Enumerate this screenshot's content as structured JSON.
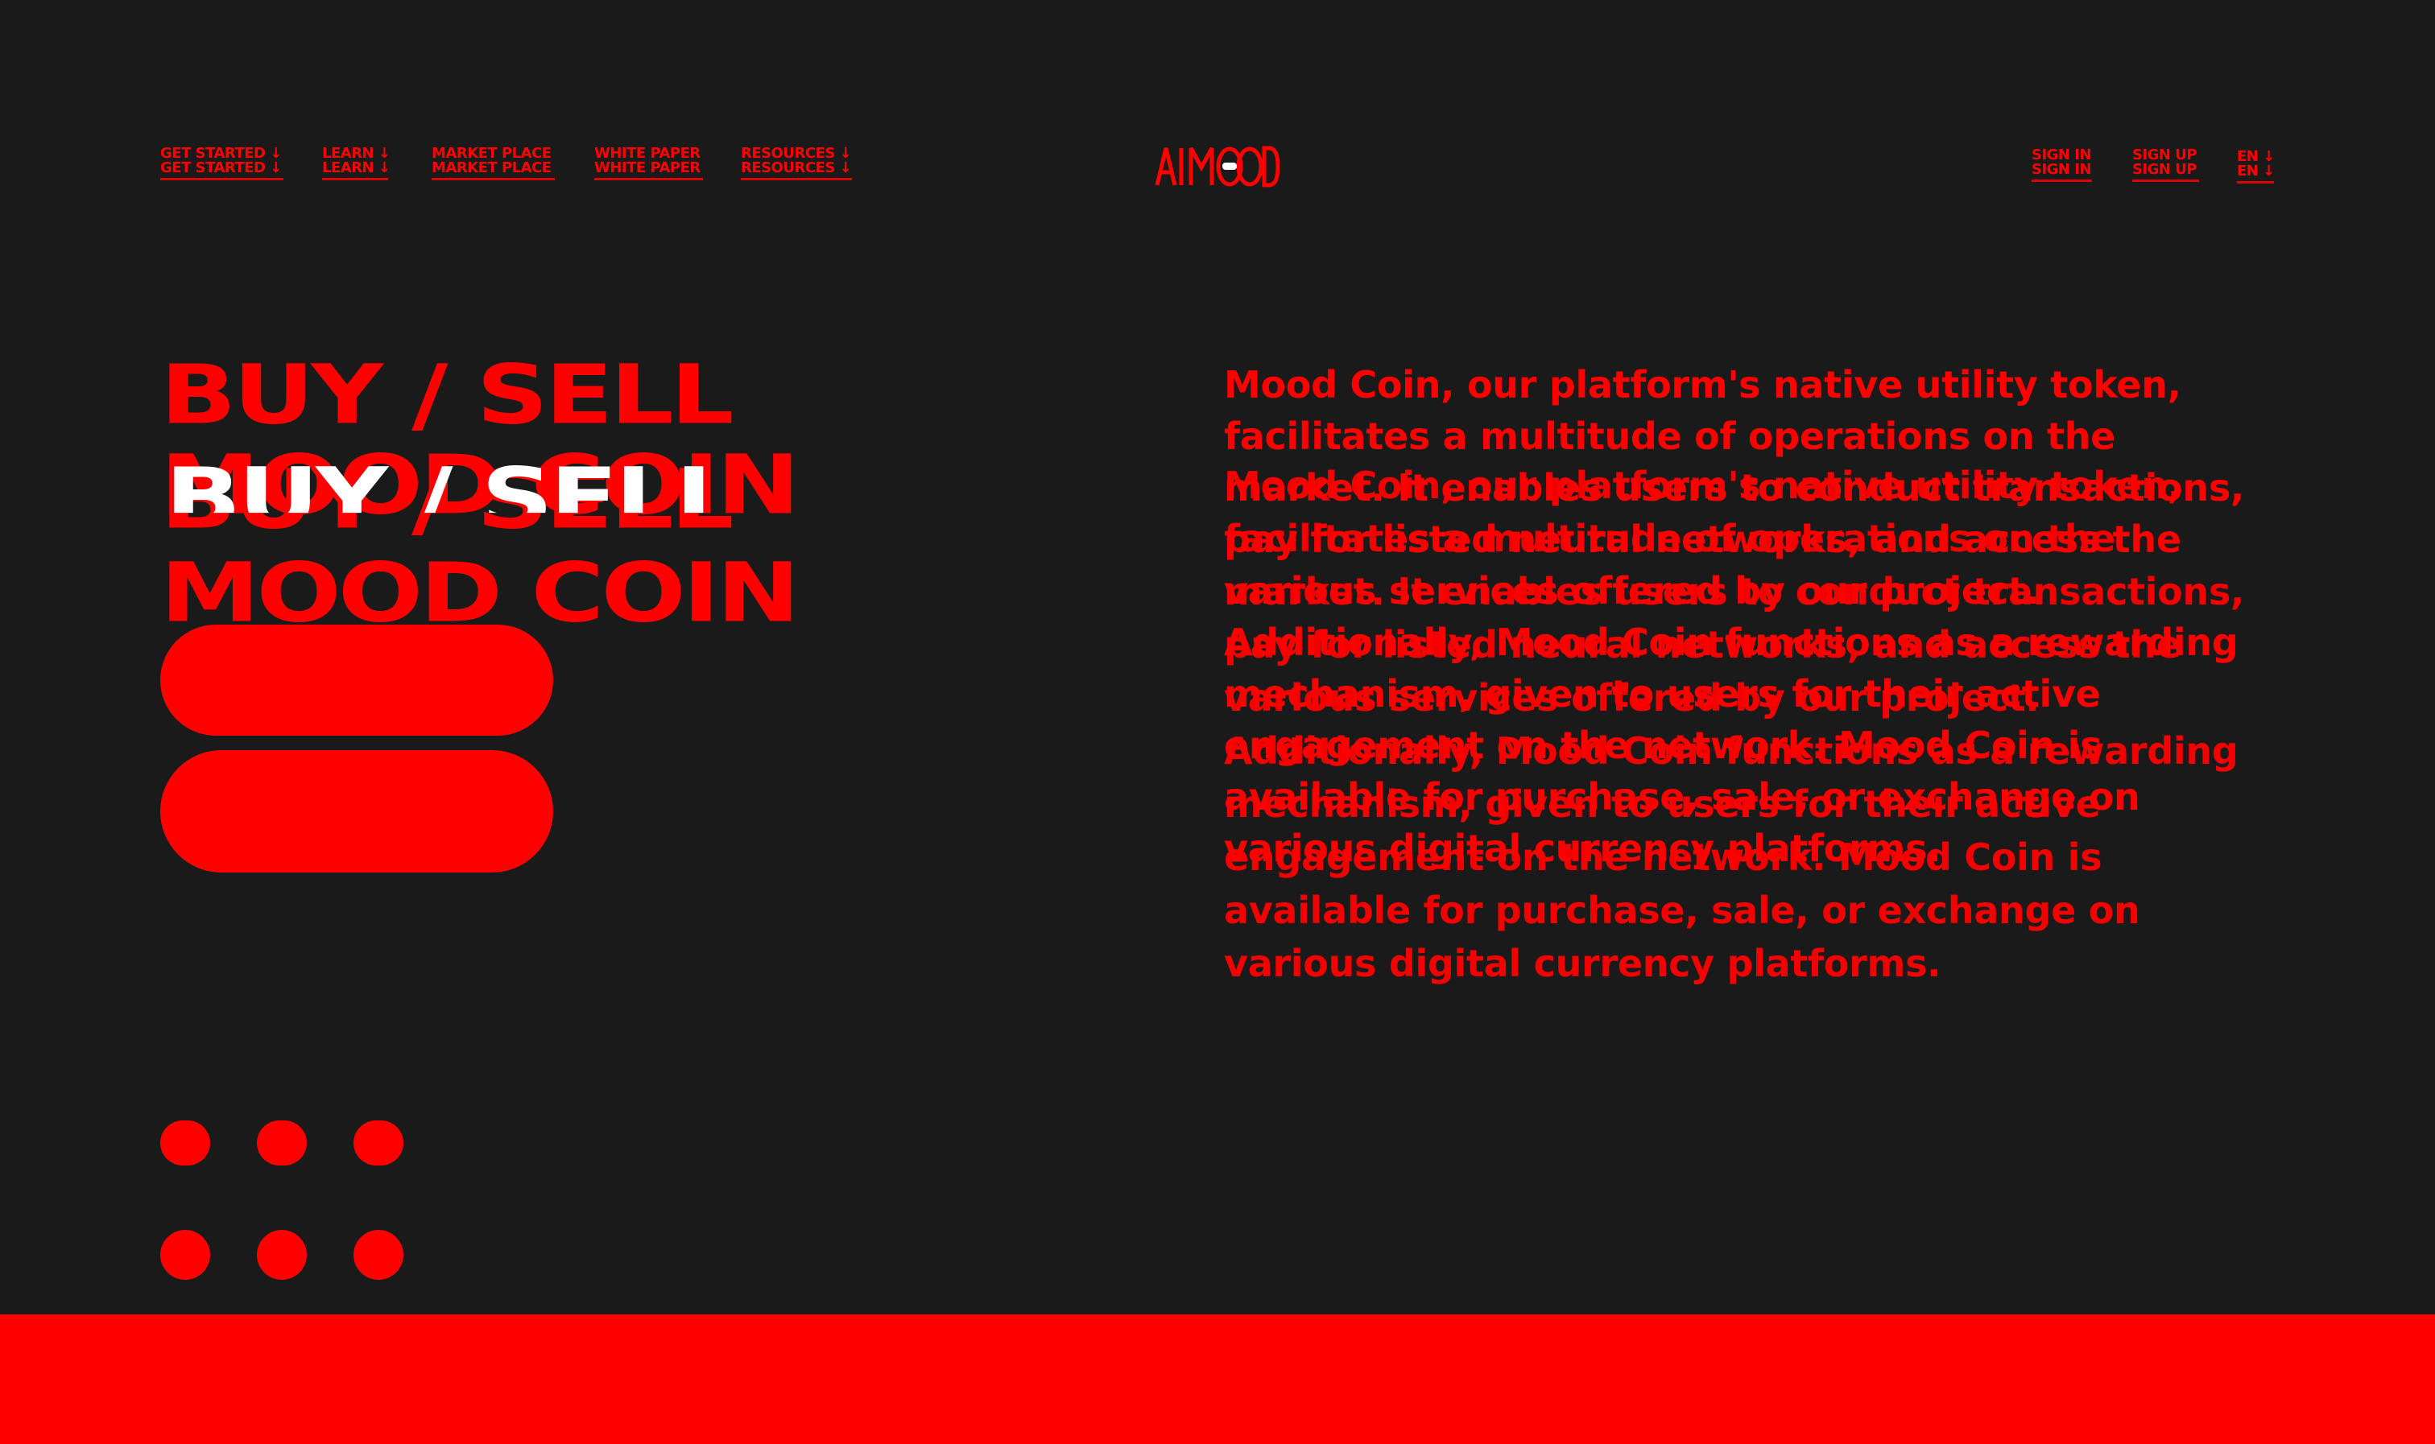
{
  "theme": {
    "background": "#1a1a1b",
    "accent": "#ff0000",
    "highlight": "#ffffff"
  },
  "nav": {
    "left": [
      {
        "label": "GET STARTED ↓"
      },
      {
        "label": "LEARN ↓"
      },
      {
        "label": "MARKET PLACE"
      },
      {
        "label": "WHITE PAPER"
      },
      {
        "label": "RESOURCES ↓"
      }
    ],
    "right": [
      {
        "label": "SIGN IN"
      },
      {
        "label": "SIGN UP"
      },
      {
        "label": "EN ↓"
      }
    ],
    "logo_text": "AI MOOD"
  },
  "hero": {
    "title_line1": "BUY / SELL",
    "title_line2": "MOOD COIN",
    "buttons": [
      {
        "label": ""
      },
      {
        "label": ""
      }
    ]
  },
  "description": {
    "text": "Mood Coin, our platform's native utility token, facilitates a multitude of operations on the market. It enables users to conduct transactions, pay for listed neural networks, and access the various services offered by our project. Additionally, Mood Coin functions as a rewarding mechanism, given to users for their active engagement on the network. Mood Coin is available for purchase, sale, or exchange on various digital currency platforms."
  },
  "pagination": {
    "dots_count": 6
  }
}
